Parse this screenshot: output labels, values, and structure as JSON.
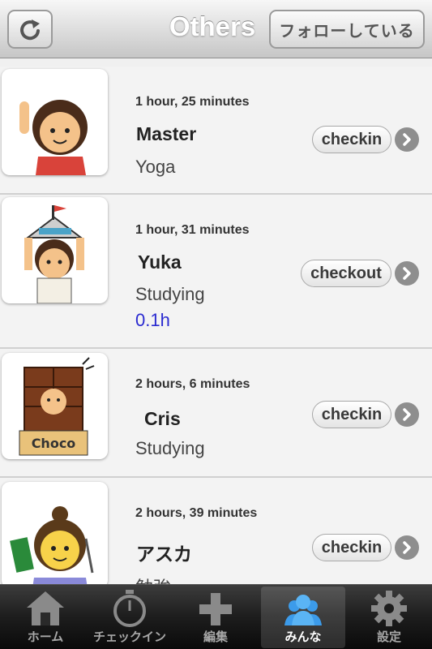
{
  "header": {
    "title": "Others",
    "follow_button": "フォローしている",
    "refresh_icon": "refresh-icon"
  },
  "rows": [
    {
      "elapsed": "1 hour, 25 minutes",
      "name": "Master",
      "activity": "Yoga",
      "hours": "",
      "action": "checkin"
    },
    {
      "elapsed": "1 hour, 31 minutes",
      "name": "Yuka",
      "activity": "Studying",
      "hours": "0.1h",
      "action": "checkout"
    },
    {
      "elapsed": "2 hours, 6 minutes",
      "name": "Cris",
      "activity": "Studying",
      "hours": "",
      "action": "checkin"
    },
    {
      "elapsed": "2 hours, 39 minutes",
      "name": "アスカ",
      "activity": "勉強",
      "hours": "",
      "action": "checkin"
    }
  ],
  "tabbar": {
    "items": [
      {
        "label": "ホーム",
        "icon": "home-icon"
      },
      {
        "label": "チェックイン",
        "icon": "stopwatch-icon"
      },
      {
        "label": "編集",
        "icon": "plus-icon"
      },
      {
        "label": "みんな",
        "icon": "people-icon",
        "active": true
      },
      {
        "label": "設定",
        "icon": "gear-icon"
      }
    ]
  },
  "colors": {
    "hours_text": "#2a2ad0",
    "active_tab_icon": "#3c9bea"
  }
}
